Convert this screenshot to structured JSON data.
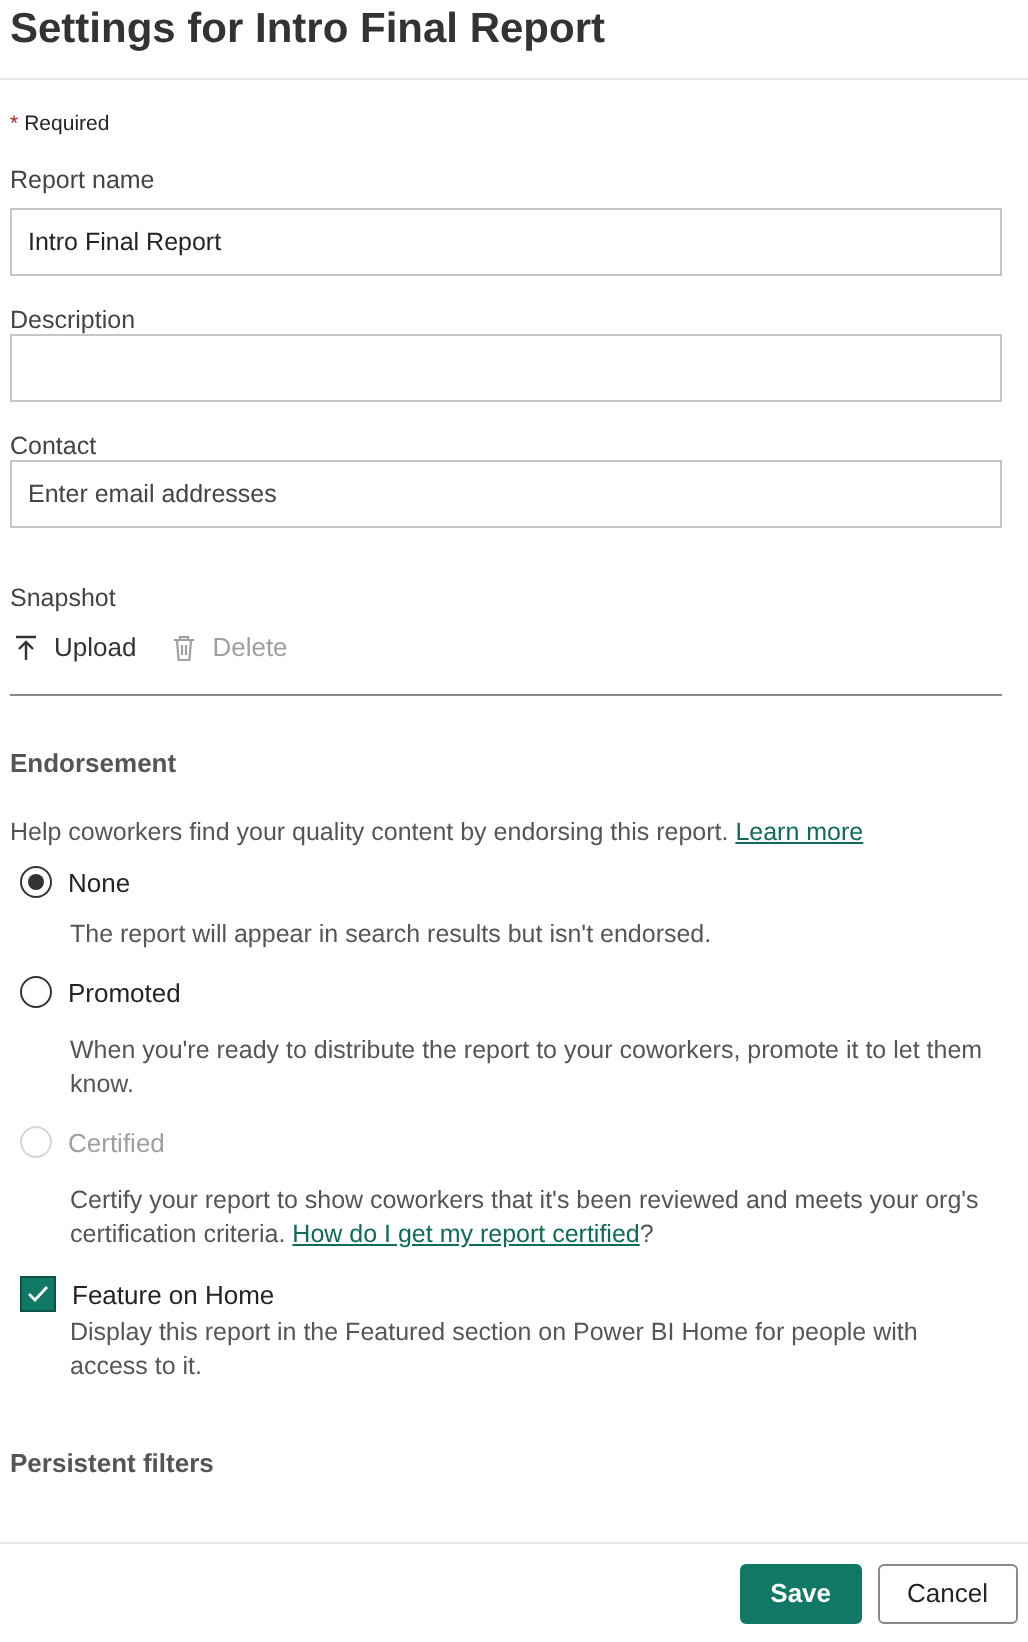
{
  "title": "Settings for Intro Final Report",
  "required_note": {
    "mark": "*",
    "label": "Required"
  },
  "fields": [
    {
      "label": "Report name",
      "value": "Intro Final Report"
    },
    {
      "label": "Description"
    },
    {
      "label": "Contact",
      "placeholder": "Enter email addresses"
    }
  ],
  "snapshot": {
    "label": "Snapshot",
    "actions": [
      {
        "label": "Upload",
        "kind": "upload",
        "disabled": false
      },
      {
        "label": "Delete",
        "kind": "delete",
        "disabled": true
      }
    ]
  },
  "endorsement": {
    "heading": "Endorsement",
    "help": "Help coworkers find your quality content by endorsing this report.",
    "help_link": "Learn more",
    "options": [
      {
        "label": "None",
        "selected": true,
        "disabled": false,
        "description": "The report will appear in search results but isn't endorsed."
      },
      {
        "label": "Promoted",
        "selected": false,
        "disabled": false,
        "description": "When you're ready to distribute the report to your coworkers, promote it to let them know."
      },
      {
        "label": "Certified",
        "selected": false,
        "disabled": true,
        "description": "Certify your report to show coworkers that it's been reviewed and meets your org's certification criteria.",
        "link": "How do I get my report certified",
        "after_link": "?"
      }
    ]
  },
  "feature": {
    "label": "Feature on Home",
    "checked": true,
    "description": "Display this report in the Featured section on Power BI Home for people with access to it."
  },
  "next_section": "Persistent filters",
  "buttons": [
    {
      "label": "Save",
      "kind": "primary"
    },
    {
      "label": "Cancel",
      "kind": "secondary"
    }
  ]
}
